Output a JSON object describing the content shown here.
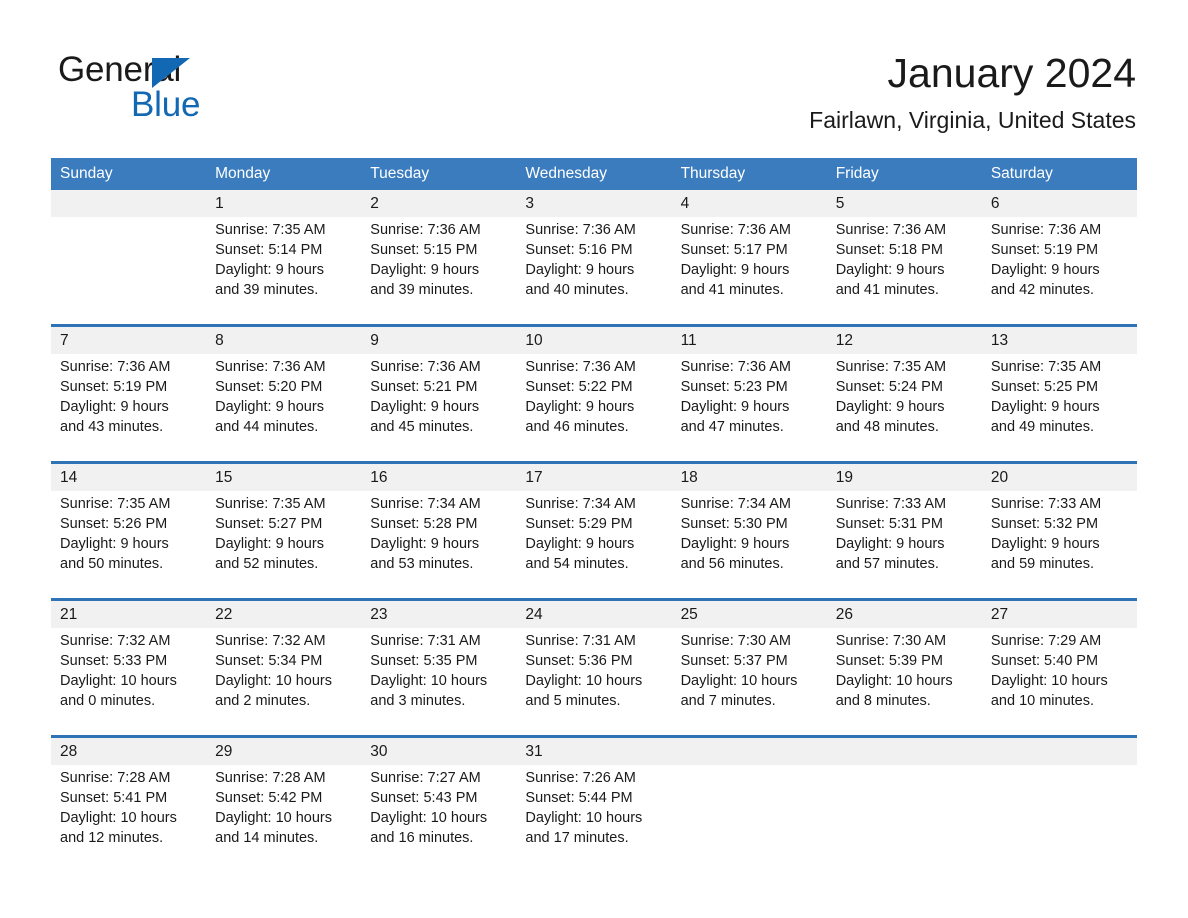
{
  "brand": {
    "name_part1": "General",
    "name_part2": "Blue",
    "logo_icon": "triangle-icon",
    "accent_color": "#1268b3"
  },
  "header": {
    "title": "January 2024",
    "subtitle": "Fairlawn, Virginia, United States"
  },
  "colors": {
    "header_blue": "#3a7cbe",
    "row_divider_blue": "#2f72b5",
    "daynum_band": "#f1f1f1",
    "text": "#1a1a1a"
  },
  "weekdays": [
    "Sunday",
    "Monday",
    "Tuesday",
    "Wednesday",
    "Thursday",
    "Friday",
    "Saturday"
  ],
  "weeks": [
    {
      "days": [
        {
          "num": "",
          "sunrise": "",
          "sunset": "",
          "daylight1": "",
          "daylight2": "",
          "empty": true
        },
        {
          "num": "1",
          "sunrise": "Sunrise: 7:35 AM",
          "sunset": "Sunset: 5:14 PM",
          "daylight1": "Daylight: 9 hours",
          "daylight2": "and 39 minutes.",
          "empty": false
        },
        {
          "num": "2",
          "sunrise": "Sunrise: 7:36 AM",
          "sunset": "Sunset: 5:15 PM",
          "daylight1": "Daylight: 9 hours",
          "daylight2": "and 39 minutes.",
          "empty": false
        },
        {
          "num": "3",
          "sunrise": "Sunrise: 7:36 AM",
          "sunset": "Sunset: 5:16 PM",
          "daylight1": "Daylight: 9 hours",
          "daylight2": "and 40 minutes.",
          "empty": false
        },
        {
          "num": "4",
          "sunrise": "Sunrise: 7:36 AM",
          "sunset": "Sunset: 5:17 PM",
          "daylight1": "Daylight: 9 hours",
          "daylight2": "and 41 minutes.",
          "empty": false
        },
        {
          "num": "5",
          "sunrise": "Sunrise: 7:36 AM",
          "sunset": "Sunset: 5:18 PM",
          "daylight1": "Daylight: 9 hours",
          "daylight2": "and 41 minutes.",
          "empty": false
        },
        {
          "num": "6",
          "sunrise": "Sunrise: 7:36 AM",
          "sunset": "Sunset: 5:19 PM",
          "daylight1": "Daylight: 9 hours",
          "daylight2": "and 42 minutes.",
          "empty": false
        }
      ]
    },
    {
      "days": [
        {
          "num": "7",
          "sunrise": "Sunrise: 7:36 AM",
          "sunset": "Sunset: 5:19 PM",
          "daylight1": "Daylight: 9 hours",
          "daylight2": "and 43 minutes.",
          "empty": false
        },
        {
          "num": "8",
          "sunrise": "Sunrise: 7:36 AM",
          "sunset": "Sunset: 5:20 PM",
          "daylight1": "Daylight: 9 hours",
          "daylight2": "and 44 minutes.",
          "empty": false
        },
        {
          "num": "9",
          "sunrise": "Sunrise: 7:36 AM",
          "sunset": "Sunset: 5:21 PM",
          "daylight1": "Daylight: 9 hours",
          "daylight2": "and 45 minutes.",
          "empty": false
        },
        {
          "num": "10",
          "sunrise": "Sunrise: 7:36 AM",
          "sunset": "Sunset: 5:22 PM",
          "daylight1": "Daylight: 9 hours",
          "daylight2": "and 46 minutes.",
          "empty": false
        },
        {
          "num": "11",
          "sunrise": "Sunrise: 7:36 AM",
          "sunset": "Sunset: 5:23 PM",
          "daylight1": "Daylight: 9 hours",
          "daylight2": "and 47 minutes.",
          "empty": false
        },
        {
          "num": "12",
          "sunrise": "Sunrise: 7:35 AM",
          "sunset": "Sunset: 5:24 PM",
          "daylight1": "Daylight: 9 hours",
          "daylight2": "and 48 minutes.",
          "empty": false
        },
        {
          "num": "13",
          "sunrise": "Sunrise: 7:35 AM",
          "sunset": "Sunset: 5:25 PM",
          "daylight1": "Daylight: 9 hours",
          "daylight2": "and 49 minutes.",
          "empty": false
        }
      ]
    },
    {
      "days": [
        {
          "num": "14",
          "sunrise": "Sunrise: 7:35 AM",
          "sunset": "Sunset: 5:26 PM",
          "daylight1": "Daylight: 9 hours",
          "daylight2": "and 50 minutes.",
          "empty": false
        },
        {
          "num": "15",
          "sunrise": "Sunrise: 7:35 AM",
          "sunset": "Sunset: 5:27 PM",
          "daylight1": "Daylight: 9 hours",
          "daylight2": "and 52 minutes.",
          "empty": false
        },
        {
          "num": "16",
          "sunrise": "Sunrise: 7:34 AM",
          "sunset": "Sunset: 5:28 PM",
          "daylight1": "Daylight: 9 hours",
          "daylight2": "and 53 minutes.",
          "empty": false
        },
        {
          "num": "17",
          "sunrise": "Sunrise: 7:34 AM",
          "sunset": "Sunset: 5:29 PM",
          "daylight1": "Daylight: 9 hours",
          "daylight2": "and 54 minutes.",
          "empty": false
        },
        {
          "num": "18",
          "sunrise": "Sunrise: 7:34 AM",
          "sunset": "Sunset: 5:30 PM",
          "daylight1": "Daylight: 9 hours",
          "daylight2": "and 56 minutes.",
          "empty": false
        },
        {
          "num": "19",
          "sunrise": "Sunrise: 7:33 AM",
          "sunset": "Sunset: 5:31 PM",
          "daylight1": "Daylight: 9 hours",
          "daylight2": "and 57 minutes.",
          "empty": false
        },
        {
          "num": "20",
          "sunrise": "Sunrise: 7:33 AM",
          "sunset": "Sunset: 5:32 PM",
          "daylight1": "Daylight: 9 hours",
          "daylight2": "and 59 minutes.",
          "empty": false
        }
      ]
    },
    {
      "days": [
        {
          "num": "21",
          "sunrise": "Sunrise: 7:32 AM",
          "sunset": "Sunset: 5:33 PM",
          "daylight1": "Daylight: 10 hours",
          "daylight2": "and 0 minutes.",
          "empty": false
        },
        {
          "num": "22",
          "sunrise": "Sunrise: 7:32 AM",
          "sunset": "Sunset: 5:34 PM",
          "daylight1": "Daylight: 10 hours",
          "daylight2": "and 2 minutes.",
          "empty": false
        },
        {
          "num": "23",
          "sunrise": "Sunrise: 7:31 AM",
          "sunset": "Sunset: 5:35 PM",
          "daylight1": "Daylight: 10 hours",
          "daylight2": "and 3 minutes.",
          "empty": false
        },
        {
          "num": "24",
          "sunrise": "Sunrise: 7:31 AM",
          "sunset": "Sunset: 5:36 PM",
          "daylight1": "Daylight: 10 hours",
          "daylight2": "and 5 minutes.",
          "empty": false
        },
        {
          "num": "25",
          "sunrise": "Sunrise: 7:30 AM",
          "sunset": "Sunset: 5:37 PM",
          "daylight1": "Daylight: 10 hours",
          "daylight2": "and 7 minutes.",
          "empty": false
        },
        {
          "num": "26",
          "sunrise": "Sunrise: 7:30 AM",
          "sunset": "Sunset: 5:39 PM",
          "daylight1": "Daylight: 10 hours",
          "daylight2": "and 8 minutes.",
          "empty": false
        },
        {
          "num": "27",
          "sunrise": "Sunrise: 7:29 AM",
          "sunset": "Sunset: 5:40 PM",
          "daylight1": "Daylight: 10 hours",
          "daylight2": "and 10 minutes.",
          "empty": false
        }
      ]
    },
    {
      "days": [
        {
          "num": "28",
          "sunrise": "Sunrise: 7:28 AM",
          "sunset": "Sunset: 5:41 PM",
          "daylight1": "Daylight: 10 hours",
          "daylight2": "and 12 minutes.",
          "empty": false
        },
        {
          "num": "29",
          "sunrise": "Sunrise: 7:28 AM",
          "sunset": "Sunset: 5:42 PM",
          "daylight1": "Daylight: 10 hours",
          "daylight2": "and 14 minutes.",
          "empty": false
        },
        {
          "num": "30",
          "sunrise": "Sunrise: 7:27 AM",
          "sunset": "Sunset: 5:43 PM",
          "daylight1": "Daylight: 10 hours",
          "daylight2": "and 16 minutes.",
          "empty": false
        },
        {
          "num": "31",
          "sunrise": "Sunrise: 7:26 AM",
          "sunset": "Sunset: 5:44 PM",
          "daylight1": "Daylight: 10 hours",
          "daylight2": "and 17 minutes.",
          "empty": false
        },
        {
          "num": "",
          "sunrise": "",
          "sunset": "",
          "daylight1": "",
          "daylight2": "",
          "empty": true
        },
        {
          "num": "",
          "sunrise": "",
          "sunset": "",
          "daylight1": "",
          "daylight2": "",
          "empty": true
        },
        {
          "num": "",
          "sunrise": "",
          "sunset": "",
          "daylight1": "",
          "daylight2": "",
          "empty": true
        }
      ]
    }
  ]
}
